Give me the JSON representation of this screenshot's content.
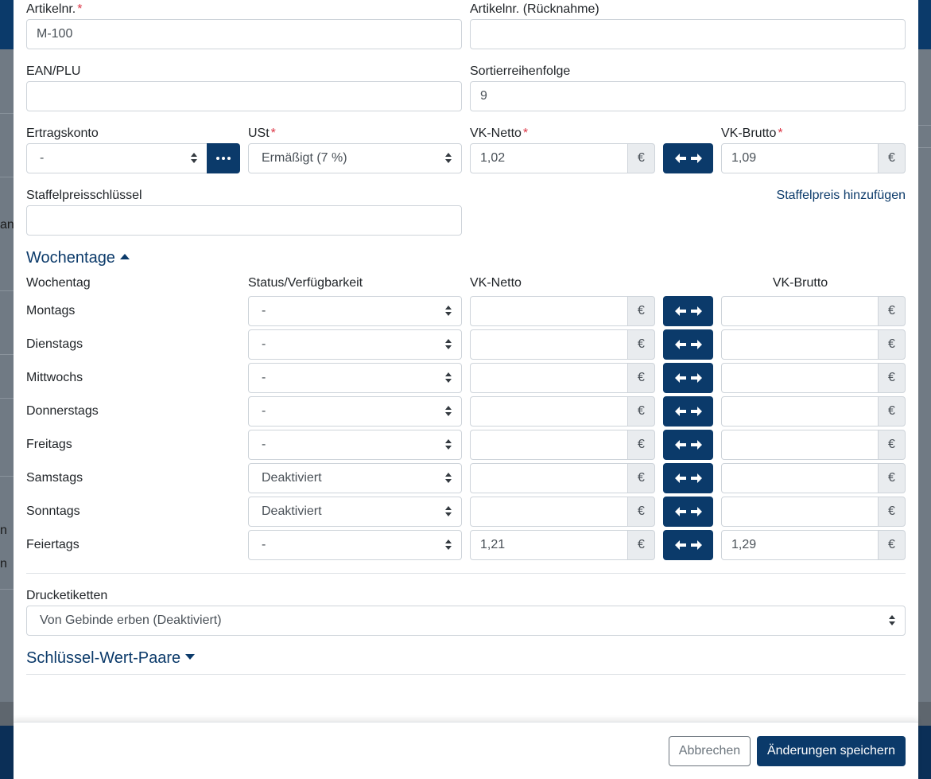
{
  "background": {
    "fragments": [
      "an",
      "n",
      "n"
    ]
  },
  "form": {
    "article_number": {
      "label": "Artikelnr.",
      "required": "*",
      "value": "M-100"
    },
    "article_number_return": {
      "label": "Artikelnr. (Rücknahme)",
      "value": ""
    },
    "ean_plu": {
      "label": "EAN/PLU",
      "value": ""
    },
    "sort_order": {
      "label": "Sortierreihenfolge",
      "value": "9"
    },
    "revenue_account": {
      "label": "Ertragskonto",
      "value": "-"
    },
    "vat": {
      "label": "USt",
      "required": "*",
      "value": "Ermäßigt (7 %)"
    },
    "net_price": {
      "label": "VK-Netto",
      "required": "*",
      "value": "1,02",
      "currency": "€"
    },
    "gross_price": {
      "label": "VK-Brutto",
      "required": "*",
      "value": "1,09",
      "currency": "€"
    },
    "tier_price_key": {
      "label": "Staffelpreisschlüssel",
      "value": ""
    },
    "add_tier_price_link": "Staffelpreis hinzufügen"
  },
  "weekdays": {
    "title": "Wochentage",
    "headers": {
      "weekday": "Wochentag",
      "status": "Status/Verfügbarkeit",
      "net": "VK-Netto",
      "gross": "VK-Brutto"
    },
    "currency": "€",
    "rows": [
      {
        "day": "Montags",
        "status": "-",
        "net": "",
        "gross": ""
      },
      {
        "day": "Dienstags",
        "status": "-",
        "net": "",
        "gross": ""
      },
      {
        "day": "Mittwochs",
        "status": "-",
        "net": "",
        "gross": ""
      },
      {
        "day": "Donnerstags",
        "status": "-",
        "net": "",
        "gross": ""
      },
      {
        "day": "Freitags",
        "status": "-",
        "net": "",
        "gross": ""
      },
      {
        "day": "Samstags",
        "status": "Deaktiviert",
        "net": "",
        "gross": ""
      },
      {
        "day": "Sonntags",
        "status": "Deaktiviert",
        "net": "",
        "gross": ""
      },
      {
        "day": "Feiertags",
        "status": "-",
        "net": "1,21",
        "gross": "1,29"
      }
    ]
  },
  "print_labels": {
    "label": "Drucketiketten",
    "value": "Von Gebinde erben (Deaktiviert)"
  },
  "key_value_pairs": {
    "title": "Schlüssel-Wert-Paare"
  },
  "footer": {
    "cancel_label": "Abbrechen",
    "save_label": "Änderungen speichern"
  },
  "colors": {
    "primary": "#0b3a6a",
    "required": "#dc3545",
    "addon_bg": "#e9ecef"
  }
}
